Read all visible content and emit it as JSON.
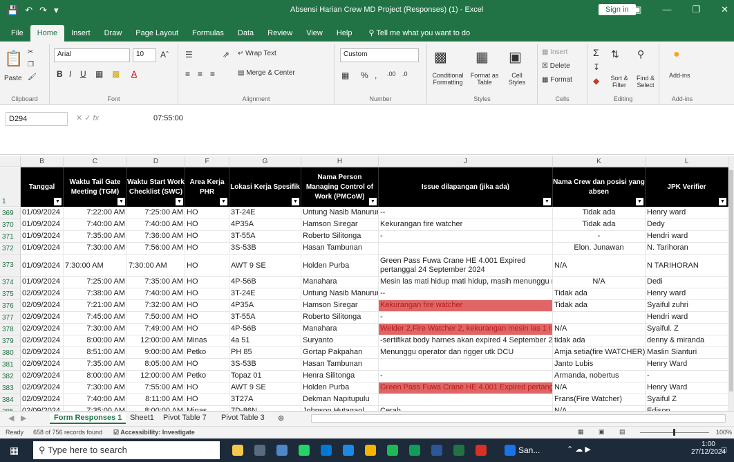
{
  "window": {
    "title": "Absensi Harian Crew MD Project (Responses) (1) - Excel",
    "signin": "Sign in",
    "colors": {
      "brand": "#217346",
      "highlight": "#e06666"
    }
  },
  "tabs": [
    "File",
    "Home",
    "Insert",
    "Draw",
    "Page Layout",
    "Formulas",
    "Data",
    "Review",
    "View",
    "Help"
  ],
  "tellme": "Tell me what you want to do",
  "ribbon": {
    "clipboard": {
      "paste": "Paste",
      "label": "Clipboard"
    },
    "font": {
      "name": "Arial",
      "size": "10",
      "label": "Font"
    },
    "alignment": {
      "wrap": "Wrap Text",
      "merge": "Merge & Center",
      "label": "Alignment"
    },
    "number": {
      "format": "Custom",
      "label": "Number"
    },
    "styles": {
      "conditional": "Conditional Formatting",
      "format_table": "Format as Table",
      "cell_styles": "Cell Styles",
      "label": "Styles"
    },
    "cells": {
      "insert": "Insert",
      "delete": "Delete",
      "format": "Format",
      "label": "Cells"
    },
    "editing": {
      "sort": "Sort & Filter",
      "find": "Find & Select",
      "label": "Editing"
    },
    "addins": {
      "btn": "Add-ins",
      "label": "Add-ins"
    }
  },
  "formula": {
    "namebox": "D294",
    "value": "07:55:00"
  },
  "columns": [
    "B",
    "C",
    "D",
    "F",
    "G",
    "H",
    "J",
    "K",
    "L"
  ],
  "headers": [
    "Tanggal",
    "Waktu Tail Gate Meeting (TGM)",
    "Waktu Start Work Checklist (SWC)",
    "Area Kerja PHR",
    "Lokasi Kerja Spesifik",
    "Nama Person Managing Control of Work (PMCoW)",
    "Issue dilapangan (jika ada)",
    "Nama Crew dan posisi yang absen",
    "JPK Verifier"
  ],
  "rows": [
    {
      "n": "369",
      "c": [
        "01/09/2024",
        "7:22:00 AM",
        "7:25:00 AM",
        "HO",
        "3T-24E",
        "Untung Nasib Manurung",
        "--",
        "Tidak ada",
        "Henry ward"
      ]
    },
    {
      "n": "370",
      "c": [
        "01/09/2024",
        "7:40:00 AM",
        "7:40:00 AM",
        "HO",
        "4P35A",
        "Hamson Siregar",
        "Kekurangan fire watcher",
        "Tidak ada",
        "Dedy"
      ]
    },
    {
      "n": "371",
      "c": [
        "01/09/2024",
        "7:35:00 AM",
        "7:36:00 AM",
        "HO",
        "3T-55A",
        "Roberto Silitonga",
        "-",
        "-",
        "Hendri ward"
      ]
    },
    {
      "n": "372",
      "c": [
        "01/09/2024",
        "7:30:00 AM",
        "7:56:00 AM",
        "HO",
        "3S-53B",
        "Hasan Tambunan",
        "",
        "Elon. Junawan",
        "N. Tarihoran"
      ]
    },
    {
      "n": "373",
      "c": [
        "01/09/2024",
        "7:30:00 AM",
        "7:30:00 AM",
        "HO",
        "AWT 9 SE",
        "Holden Purba",
        "Green Pass Fuwa Crane HE 4.001 Expired pertanggal 24 September 2024",
        "N/A",
        "N TARIHORAN"
      ]
    },
    {
      "n": "374",
      "c": [
        "01/09/2024",
        "7:25:00 AM",
        "7:35:00 AM",
        "HO",
        "4P-56B",
        "Manahara",
        "Mesin las mati hidup mati hidup, masih menunggu m",
        "N/A",
        "Dedi"
      ]
    },
    {
      "n": "375",
      "c": [
        "02/09/2024",
        "7:38:00 AM",
        "7:40:00 AM",
        "HO",
        "3T-24E",
        "Untung Nasib Manurung",
        "--",
        "Tidak ada",
        "Henry ward"
      ]
    },
    {
      "n": "376",
      "c": [
        "02/09/2024",
        "7:21:00 AM",
        "7:32:00 AM",
        "HO",
        "4P35A",
        "Hamson Siregar",
        "Kekurangan fire watcher",
        "Tidak ada",
        "Syaiful zuhri"
      ]
    },
    {
      "n": "377",
      "c": [
        "02/09/2024",
        "7:45:00 AM",
        "7:50:00 AM",
        "HO",
        "3T-55A",
        "Roberto Silitonga",
        "-",
        "",
        "Hendri ward"
      ]
    },
    {
      "n": "378",
      "c": [
        "02/09/2024",
        "7:30:00 AM",
        "7:49:00 AM",
        "HO",
        "4P-56B",
        "Manahara",
        "Welder 2,Fire Watcher 2, kekurangan mesin las 1 rad",
        "N/A",
        "Syaiful. Z"
      ]
    },
    {
      "n": "379",
      "c": [
        "02/09/2024",
        "8:00:00 AM",
        "12:00:00 AM",
        "Minas",
        "4a 51",
        "Suryanto",
        "-sertifikat body harnes akan expired 4 September 20",
        "tidak ada",
        "denny & miranda"
      ]
    },
    {
      "n": "380",
      "c": [
        "02/09/2024",
        "8:51:00 AM",
        "9:00:00 AM",
        "Petko",
        "PH 85",
        "Gortap Pakpahan",
        "Menunggu operator dan rigger utk DCU",
        "Amja setia(fire WATCHER) iz",
        "Maslin Sianturi"
      ]
    },
    {
      "n": "381",
      "c": [
        "02/09/2024",
        "7:35:00 AM",
        "8:05:00 AM",
        "HO",
        "3S-53B",
        "Hasan Tambunan",
        "",
        "Janto Lubis",
        "Henry Ward"
      ]
    },
    {
      "n": "382",
      "c": [
        "02/09/2024",
        "8:00:00 AM",
        "12:00:00 AM",
        "Petko",
        "Topaz 01",
        "Henra Silitonga",
        "-",
        "Armanda, nobertus",
        "-"
      ]
    },
    {
      "n": "383",
      "c": [
        "02/09/2024",
        "7:30:00 AM",
        "7:55:00 AM",
        "HO",
        "AWT 9 SE",
        "Holden Purba",
        "Green Pass Fuwa Crane HE 4.001 Expired pertanggal",
        "N/A",
        "Henry Ward"
      ]
    },
    {
      "n": "384",
      "c": [
        "02/09/2024",
        "7:40:00 AM",
        "8:11:00 AM",
        "HO",
        "3T27A",
        "Dekman Napitupulu",
        "",
        "Frans(Fire Watcher)",
        "Syaiful Z"
      ]
    },
    {
      "n": "385",
      "c": [
        "02/09/2024",
        "7:35:00 AM",
        "8:00:00 AM",
        "Minas",
        "7D-86N",
        "Johnson Hutagaol",
        "Cerah",
        "N/A",
        "Edison"
      ]
    }
  ],
  "highlighted_rows": [
    "376",
    "378",
    "383"
  ],
  "sheets": [
    "Form Responses 1",
    "Sheet1",
    "Pivot Table 7",
    "Pivot Table 3"
  ],
  "status": {
    "ready": "Ready",
    "records": "658 of 756 records found",
    "accessibility": "Accessibility: Investigate",
    "zoom": "100%"
  },
  "taskbar": {
    "search": "Type here to search",
    "app": "San...",
    "time": "1:00",
    "date": "27/12/2024"
  }
}
